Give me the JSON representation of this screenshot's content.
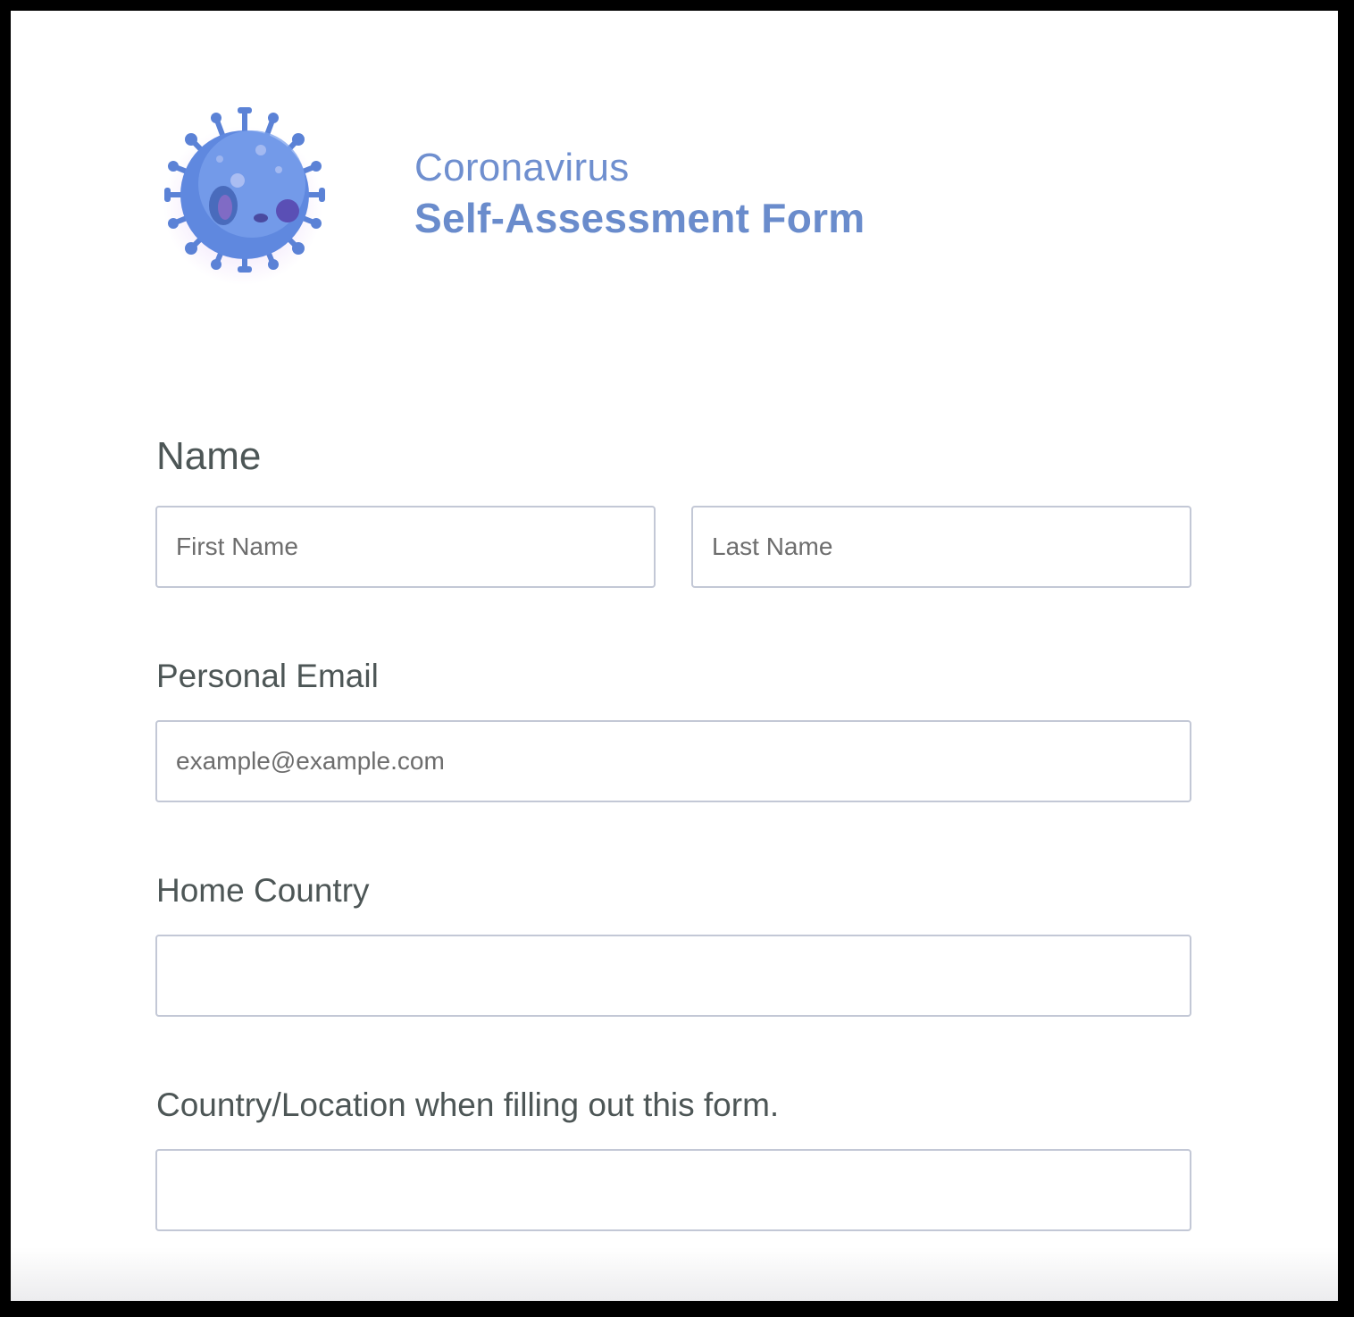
{
  "header": {
    "title_line1": "Coronavirus",
    "title_line2": "Self-Assessment Form",
    "logo_icon": "virus-icon",
    "accent_color": "#6f8fcf"
  },
  "form": {
    "name": {
      "label": "Name",
      "first_placeholder": "First Name",
      "last_placeholder": "Last Name"
    },
    "email": {
      "label": "Personal Email",
      "placeholder": "example@example.com"
    },
    "home_country": {
      "label": "Home Country",
      "value": ""
    },
    "current_location": {
      "label": "Country/Location when filling out this form.",
      "value": ""
    }
  }
}
